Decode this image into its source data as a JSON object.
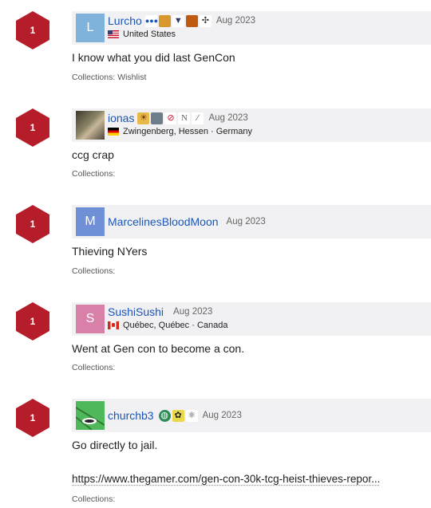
{
  "colors": {
    "rating_bg": "#b51d2b",
    "username": "#1b56b8",
    "header_bg": "#f1f1f3"
  },
  "entries": [
    {
      "rating": "1",
      "avatar_letter": "L",
      "avatar_color": "#7fb3dc",
      "username": "Lurcho",
      "badge_icons": [
        "dots-icon",
        "beer-icon",
        "anvil-icon",
        "grid-icon",
        "network-icon"
      ],
      "date": "Aug 2023",
      "location": "United States",
      "flag_icon": "us-flag-icon",
      "comment": "I know what you did last GenCon",
      "collections": "Collections: Wishlist"
    },
    {
      "rating": "1",
      "avatar_letter": "",
      "avatar_color": "#6b6a55",
      "avatar_icon": "photo-avatar",
      "username": "ionas",
      "badge_icons": [
        "sun-icon",
        "landscape-icon",
        "no-smoking-icon",
        "n-icon",
        "feather-icon"
      ],
      "date": "Aug 2023",
      "location": "Zwingenberg, Hessen · Germany",
      "flag_icon": "germany-flag-icon",
      "comment": "ccg crap",
      "collections": "Collections:"
    },
    {
      "rating": "1",
      "avatar_letter": "M",
      "avatar_color": "#6f8fd6",
      "username": "MarcelinesBloodMoon",
      "badge_icons": [],
      "date": "Aug 2023",
      "location": "",
      "comment": "Thieving NYers",
      "collections": "Collections:"
    },
    {
      "rating": "1",
      "avatar_letter": "S",
      "avatar_color": "#d980a8",
      "username": "SushiSushi",
      "badge_icons": [],
      "date": "Aug 2023",
      "location": "Québec, Québec · Canada",
      "flag_icon": "canada-flag-icon",
      "comment": "Went at Gen con to become a con.",
      "collections": "Collections:"
    },
    {
      "rating": "1",
      "avatar_letter": "",
      "avatar_color": "#4fb85a",
      "avatar_icon": "green-image-avatar",
      "username": "churchb3",
      "badge_icons": [
        "globe-icon",
        "plant-icon",
        "atom-icon"
      ],
      "date": "Aug 2023",
      "location": "",
      "comment": "Go directly to jail.",
      "link": "https://www.thegamer.com/gen-con-30k-tcg-heist-thieves-repor...",
      "collections": "Collections:"
    }
  ]
}
